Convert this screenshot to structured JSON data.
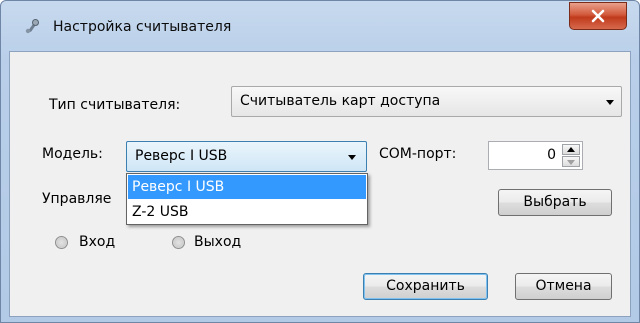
{
  "window": {
    "title": "Настройка считывателя"
  },
  "form": {
    "reader_type_label": "Тип считывателя:",
    "reader_type_value": "Считыватель карт доступа",
    "model_label": "Модель:",
    "model_value": "Реверс I USB",
    "com_port_label": "COM-порт:",
    "com_port_value": "0",
    "control_label_partial": "Управляе",
    "select_button": "Выбрать",
    "radio_in": "Вход",
    "radio_out": "Выход",
    "save_button": "Сохранить",
    "cancel_button": "Отмена"
  },
  "model_dropdown": {
    "options": [
      "Реверс I USB",
      "Z-2 USB"
    ],
    "selected": "Реверс I USB"
  },
  "colors": {
    "selection": "#3399ff",
    "close_button": "#c13a1c"
  }
}
